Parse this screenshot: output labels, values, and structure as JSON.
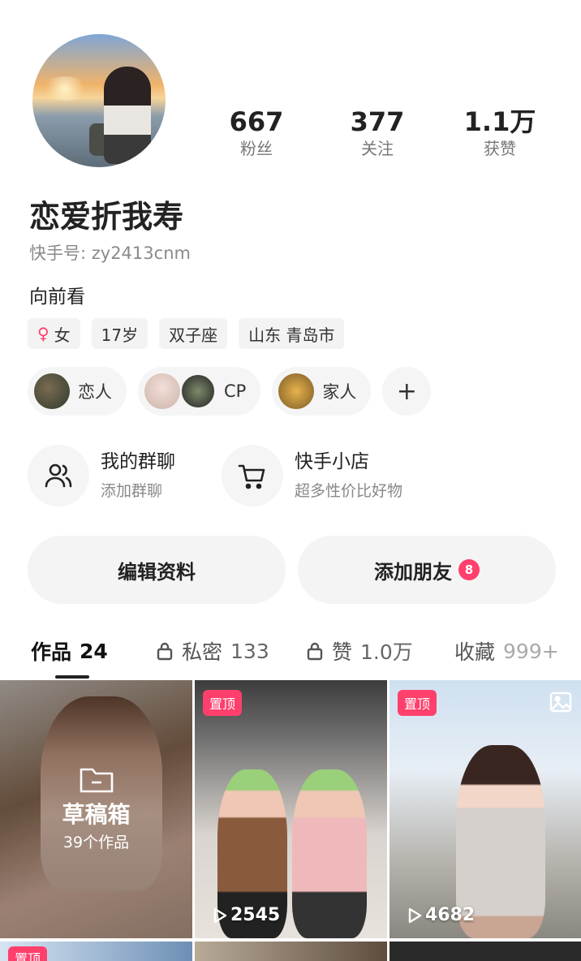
{
  "profile": {
    "nickname": "恋爱折我寿",
    "kuaishou_id": "快手号: zy2413cnm",
    "bio": "向前看"
  },
  "stats": [
    {
      "value": "667",
      "label": "粉丝"
    },
    {
      "value": "377",
      "label": "关注"
    },
    {
      "value": "1.1万",
      "label": "获赞"
    }
  ],
  "tags": {
    "gender_symbol": "♀",
    "gender": "女",
    "age": "17岁",
    "zodiac": "双子座",
    "location": "山东 青岛市"
  },
  "relations": {
    "lover": "恋人",
    "cp": "CP",
    "family": "家人",
    "add": "+"
  },
  "features": {
    "group_title": "我的群聊",
    "group_sub": "添加群聊",
    "shop_title": "快手小店",
    "shop_sub": "超多性价比好物"
  },
  "buttons": {
    "edit": "编辑资料",
    "add_friend": "添加朋友",
    "add_friend_badge": "8"
  },
  "tabs": [
    {
      "label": "作品",
      "count": "24"
    },
    {
      "label": "私密",
      "count": "133"
    },
    {
      "label": "赞",
      "count": "1.0万"
    },
    {
      "label": "收藏",
      "count": "999+"
    }
  ],
  "grid": {
    "draft_title": "草稿箱",
    "draft_sub": "39个作品",
    "pin_label": "置顶",
    "video1_plays": "2545",
    "video2_plays": "4682",
    "row2_pin": "置顶"
  },
  "colors": {
    "accent": "#ff3f6c",
    "chip_bg": "#f3f3f3"
  }
}
